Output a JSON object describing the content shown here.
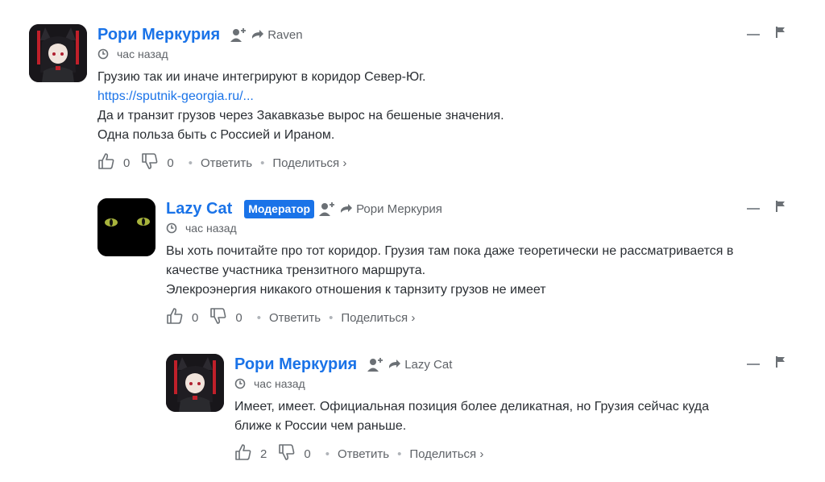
{
  "comments": [
    {
      "author": "Рори Меркурия",
      "reply_to": "Raven",
      "time": "час назад",
      "link": "https://sputnik-georgia.ru/...",
      "lines_before": [
        "Грузию так ии иначе интегрируют в коридор Север-Юг."
      ],
      "lines_after": [
        "Да и транзит грузов через Закавказье вырос на бешеные значения.",
        "Одна польза быть с Россией и Ираном."
      ],
      "likes": "0",
      "dislikes": "0",
      "reply_label": "Ответить",
      "share_label": "Поделиться ›"
    },
    {
      "author": "Lazy Cat",
      "badge": "Модератор",
      "reply_to": "Рори Меркурия",
      "time": "час назад",
      "lines": [
        "Вы хоть почитайте про тот коридор. Грузия там пока даже теоретически не рассматривается в",
        "качестве участника трензитного маршрута.",
        "Элекроэнергия никакого отношения к тарнзиту грузов не имеет"
      ],
      "likes": "0",
      "dislikes": "0",
      "reply_label": "Ответить",
      "share_label": "Поделиться ›"
    },
    {
      "author": "Рори Меркурия",
      "reply_to": "Lazy Cat",
      "time": "час назад",
      "lines": [
        "Имеет, имеет. Официальная позиция более деликатная, но Грузия сейчас куда",
        "ближе к России чем раньше."
      ],
      "likes": "2",
      "dislikes": "0",
      "reply_label": "Ответить",
      "share_label": "Поделиться ›"
    }
  ],
  "colors": {
    "author": "#1a73e8",
    "badge_bg": "#1a73e8",
    "meta": "#5f6368"
  },
  "icons": [
    "follow-icon",
    "reply-arrow-icon",
    "clock-icon",
    "thumbs-up-icon",
    "thumbs-down-icon",
    "collapse-icon",
    "flag-icon"
  ]
}
